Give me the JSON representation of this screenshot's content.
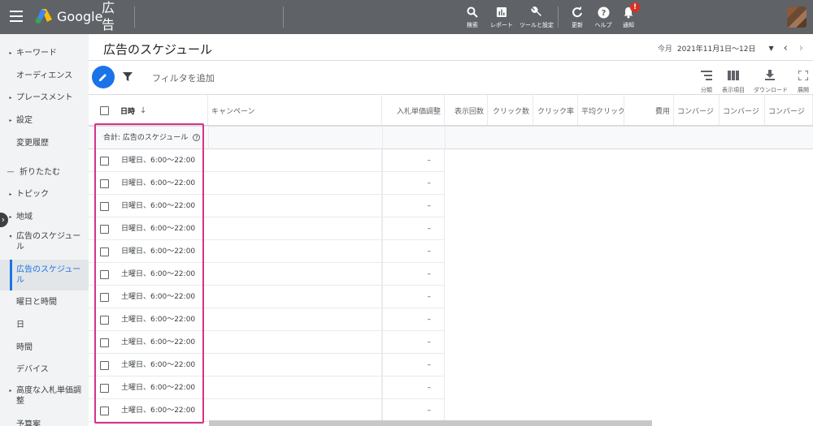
{
  "app": {
    "brand": "Google",
    "product": "広告"
  },
  "toolbar": [
    {
      "label": "検索",
      "icon": "search-icon"
    },
    {
      "label": "レポート",
      "icon": "reports-icon"
    },
    {
      "label": "ツールと設定",
      "icon": "wrench-icon"
    },
    {
      "label": "更新",
      "icon": "refresh-icon"
    },
    {
      "label": "ヘルプ",
      "icon": "help-icon"
    },
    {
      "label": "通知",
      "icon": "bell-icon"
    }
  ],
  "notifications_badge": "!",
  "sidebar": {
    "items": [
      {
        "label": "キーワード",
        "caret": "▸"
      },
      {
        "label": "オーディエンス",
        "caret": ""
      },
      {
        "label": "プレースメント",
        "caret": "▸"
      },
      {
        "label": "設定",
        "caret": "▸"
      },
      {
        "label": "変更履歴",
        "caret": ""
      },
      {
        "label": "折りたたむ",
        "caret": "—"
      },
      {
        "label": "トピック",
        "caret": "▸"
      },
      {
        "label": "地域",
        "caret": "▸"
      },
      {
        "label": "広告のスケジュール",
        "caret": "▾"
      },
      {
        "label": "広告のスケジュール",
        "caret": "",
        "active": true
      },
      {
        "label": "曜日と時間",
        "caret": ""
      },
      {
        "label": "日",
        "caret": ""
      },
      {
        "label": "時間",
        "caret": ""
      },
      {
        "label": "デバイス",
        "caret": ""
      },
      {
        "label": "高度な入札単価調整",
        "caret": "▸"
      },
      {
        "label": "予算案",
        "caret": ""
      }
    ]
  },
  "page": {
    "title": "広告のスケジュール"
  },
  "daterange": {
    "label": "今月",
    "value": "2021年11月1日～12日"
  },
  "filter": {
    "text": "フィルタを追加"
  },
  "right_tools": [
    {
      "label": "分類",
      "icon": "segment-icon"
    },
    {
      "label": "表示項目",
      "icon": "columns-icon"
    },
    {
      "label": "ダウンロード",
      "icon": "download-icon"
    },
    {
      "label": "展開",
      "icon": "expand-icon"
    }
  ],
  "table": {
    "columns": [
      "日時",
      "キャンペーン",
      "入札単価調整",
      "表示回数",
      "クリック数",
      "クリック率",
      "平均クリック",
      "費用",
      "コンバージ",
      "コンバージ",
      "コンバージ"
    ],
    "sort_indicator": "↓",
    "total_label": "合計: 広告のスケジュール",
    "rows": [
      {
        "datetime": "日曜日、6:00～22:00",
        "bid": "–"
      },
      {
        "datetime": "日曜日、6:00～22:00",
        "bid": "–"
      },
      {
        "datetime": "日曜日、6:00～22:00",
        "bid": "–"
      },
      {
        "datetime": "日曜日、6:00～22:00",
        "bid": "–"
      },
      {
        "datetime": "日曜日、6:00～22:00",
        "bid": "–"
      },
      {
        "datetime": "土曜日、6:00～22:00",
        "bid": "–"
      },
      {
        "datetime": "土曜日、6:00～22:00",
        "bid": "–"
      },
      {
        "datetime": "土曜日、6:00～22:00",
        "bid": "–"
      },
      {
        "datetime": "土曜日、6:00～22:00",
        "bid": "–"
      },
      {
        "datetime": "土曜日、6:00～22:00",
        "bid": "–"
      },
      {
        "datetime": "土曜日、6:00～22:00",
        "bid": "–"
      },
      {
        "datetime": "土曜日、6:00～22:00",
        "bid": "–"
      }
    ]
  },
  "colors": {
    "accent": "#1a73e8",
    "highlight": "#d6338a",
    "topbar": "#5f6368"
  }
}
